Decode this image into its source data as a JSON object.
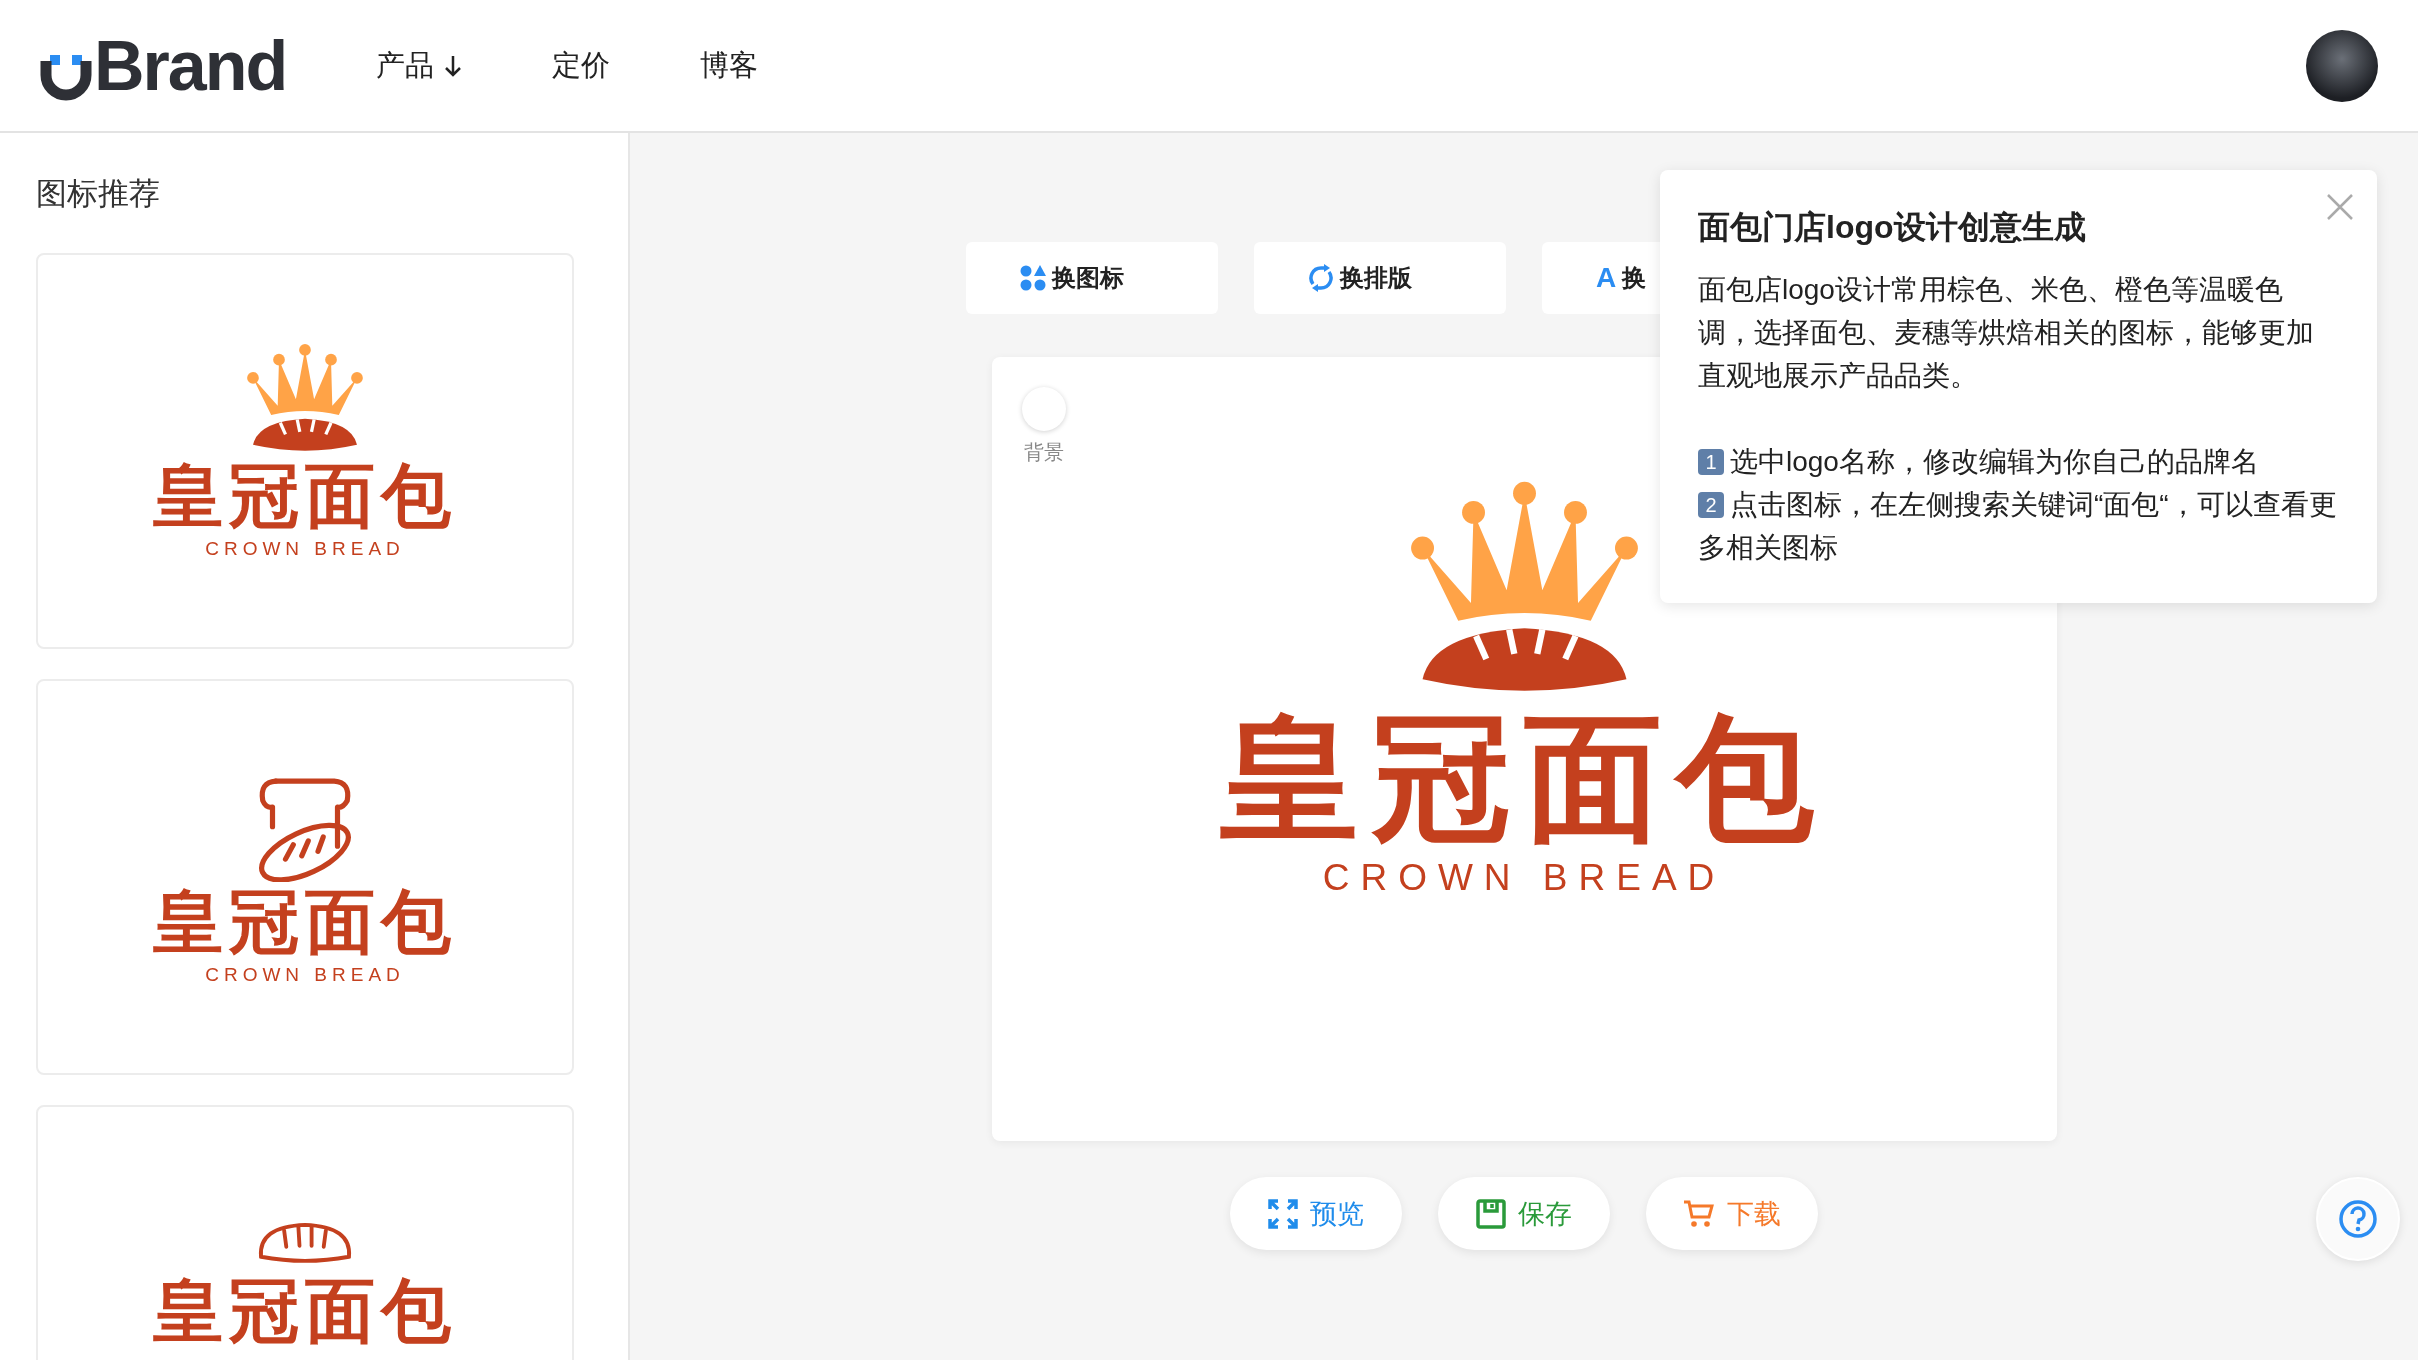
{
  "header": {
    "logo": "Brand",
    "nav": [
      {
        "label": "产品",
        "dropdown": true
      },
      {
        "label": "定价",
        "dropdown": false
      },
      {
        "label": "博客",
        "dropdown": false
      }
    ]
  },
  "sidebar": {
    "title": "图标推荐",
    "cards": [
      {
        "kind": "crown",
        "name": "皇冠面包",
        "tagline": "CROWN BREAD"
      },
      {
        "kind": "toast",
        "name": "皇冠面包",
        "tagline": "CROWN BREAD"
      },
      {
        "kind": "loaf",
        "name": "皇冠面包"
      }
    ]
  },
  "toolbar": [
    {
      "kind": "shapes",
      "label": "换图标"
    },
    {
      "kind": "refresh",
      "label": "换排版"
    },
    {
      "kind": "letter",
      "glyph": "A",
      "label": "换"
    }
  ],
  "canvas": {
    "background": {
      "label": "背景"
    },
    "logo": {
      "kind": "crown",
      "name": "皇冠面包",
      "tagline": "CROWN BREAD"
    }
  },
  "tip": {
    "title": "面包门店logo设计创意生成",
    "body": "面包店logo设计常用棕色、米色、橙色等温暖色调，选择面包、麦穗等烘焙相关的图标，能够更加直观地展示产品品类。",
    "steps": [
      {
        "number": "1",
        "text": "选中logo名称，修改编辑为你自己的品牌名"
      },
      {
        "number": "2",
        "text": "点击图标，在左侧搜索关键词“面包“，可以查看更多相关图标"
      }
    ]
  },
  "actions": [
    {
      "kind": "expand",
      "label": "预览",
      "color": "#1f8ceb"
    },
    {
      "kind": "save",
      "label": "保存",
      "color": "#2a9a3a"
    },
    {
      "kind": "cart",
      "label": "下载",
      "color": "#f5792a"
    }
  ]
}
